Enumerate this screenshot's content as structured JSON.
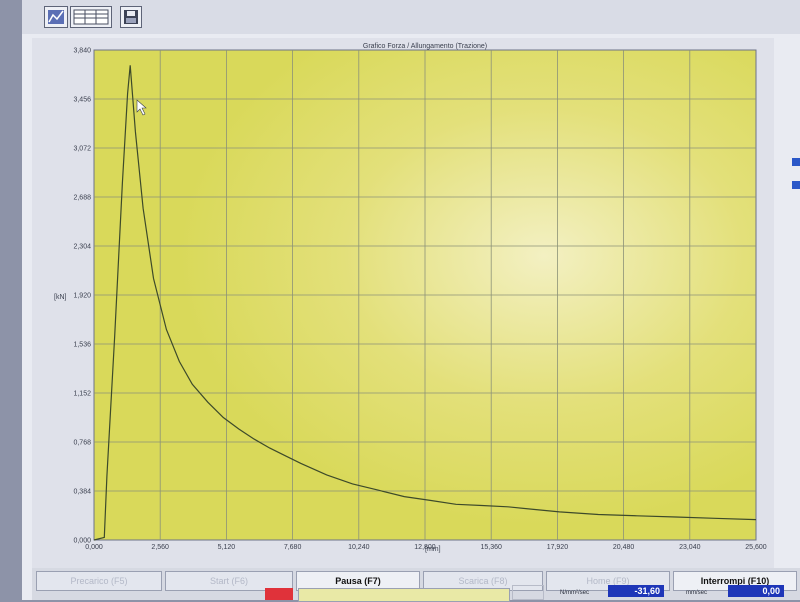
{
  "chart_title": "Grafico Forza / Allungamento (Trazione)",
  "toolbar": {
    "icons": [
      "chart-icon",
      "table-icon",
      "save-icon"
    ]
  },
  "buttons": {
    "precarico": "Precarico (F5)",
    "start": "Start (F6)",
    "pausa": "Pausa (F7)",
    "scarica": "Scarica (F8)",
    "home": "Home (F9)",
    "interrompi": "Interrompi (F10)"
  },
  "readouts": {
    "speed_unit": "mm/sec",
    "speed_value": "-31,60",
    "speed_unit_label": "N/mm²/sec",
    "second_unit": "mm/sec",
    "second_value": "0,00"
  },
  "chart_data": {
    "type": "line",
    "title": "Grafico Forza / Allungamento (Trazione)",
    "xlabel": "[mm]",
    "ylabel": "[kN]",
    "xlim": [
      0,
      25.6
    ],
    "ylim": [
      0,
      3.84
    ],
    "x_ticks": [
      "0,000",
      "2,560",
      "5,120",
      "7,680",
      "10,240",
      "12,800",
      "15,360",
      "17,920",
      "20,480",
      "23,040",
      "25,600"
    ],
    "y_ticks": [
      "0,000",
      "0,384",
      "0,768",
      "1,152",
      "1,536",
      "1,920",
      "2,304",
      "2,688",
      "3,072",
      "3,456",
      "3,840"
    ],
    "grid": true,
    "series": [
      {
        "x": [
          0,
          0.4,
          0.5,
          0.8,
          1.1,
          1.3,
          1.4,
          1.6,
          1.9,
          2.3,
          2.8,
          3.3,
          3.8,
          4.4,
          5.0,
          5.6,
          6.2,
          6.8,
          7.4,
          8.0,
          9.0,
          10.0,
          11.0,
          12.0,
          13.0,
          14.0,
          15.0,
          16.0,
          17.0,
          18.0,
          19.5,
          21.0,
          22.5,
          24.0,
          25.6
        ],
        "y": [
          0,
          0.02,
          0.5,
          1.6,
          2.8,
          3.5,
          3.72,
          3.2,
          2.6,
          2.05,
          1.65,
          1.4,
          1.22,
          1.08,
          0.96,
          0.87,
          0.79,
          0.72,
          0.66,
          0.6,
          0.51,
          0.44,
          0.39,
          0.34,
          0.31,
          0.28,
          0.27,
          0.26,
          0.24,
          0.22,
          0.2,
          0.19,
          0.18,
          0.17,
          0.16
        ]
      }
    ]
  }
}
